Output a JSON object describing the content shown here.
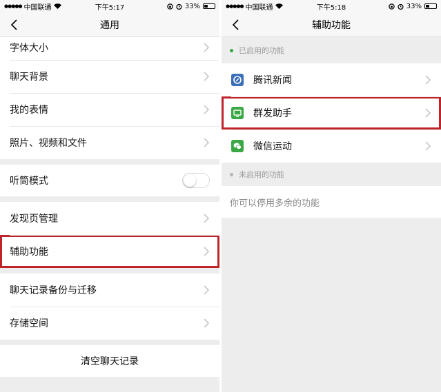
{
  "left": {
    "status": {
      "carrier": "中国联通",
      "time": "下午5:17",
      "battery": "33%",
      "battery_level": 0.33
    },
    "nav_title": "通用",
    "group1": [
      "字体大小",
      "聊天背景",
      "我的表情",
      "照片、视频和文件"
    ],
    "earpiece_mode": {
      "label": "听筒模式",
      "on": false
    },
    "discover_manage": "发现页管理",
    "accessibility": "辅助功能",
    "group3": [
      "聊天记录备份与迁移",
      "存储空间"
    ],
    "clear_history": "清空聊天记录"
  },
  "right": {
    "status": {
      "carrier": "中国联通",
      "time": "下午5:18",
      "battery": "33%",
      "battery_level": 0.33
    },
    "nav_title": "辅助功能",
    "enabled_label": "已启用的功能",
    "enabled_items": [
      {
        "label": "腾讯新闻",
        "icon": "tencent-news-icon",
        "color": "#3b6fb6"
      },
      {
        "label": "群发助手",
        "icon": "mass-send-icon",
        "color": "#3aa845"
      },
      {
        "label": "微信运动",
        "icon": "wechat-sport-icon",
        "color": "#3aa845"
      }
    ],
    "disabled_label": "未启用的功能",
    "disabled_hint": "你可以停用多余的功能"
  },
  "colors": {
    "highlight": "#c0242b",
    "enabled_dot": "#3aa845",
    "disabled_dot": "#b5b5b5"
  }
}
